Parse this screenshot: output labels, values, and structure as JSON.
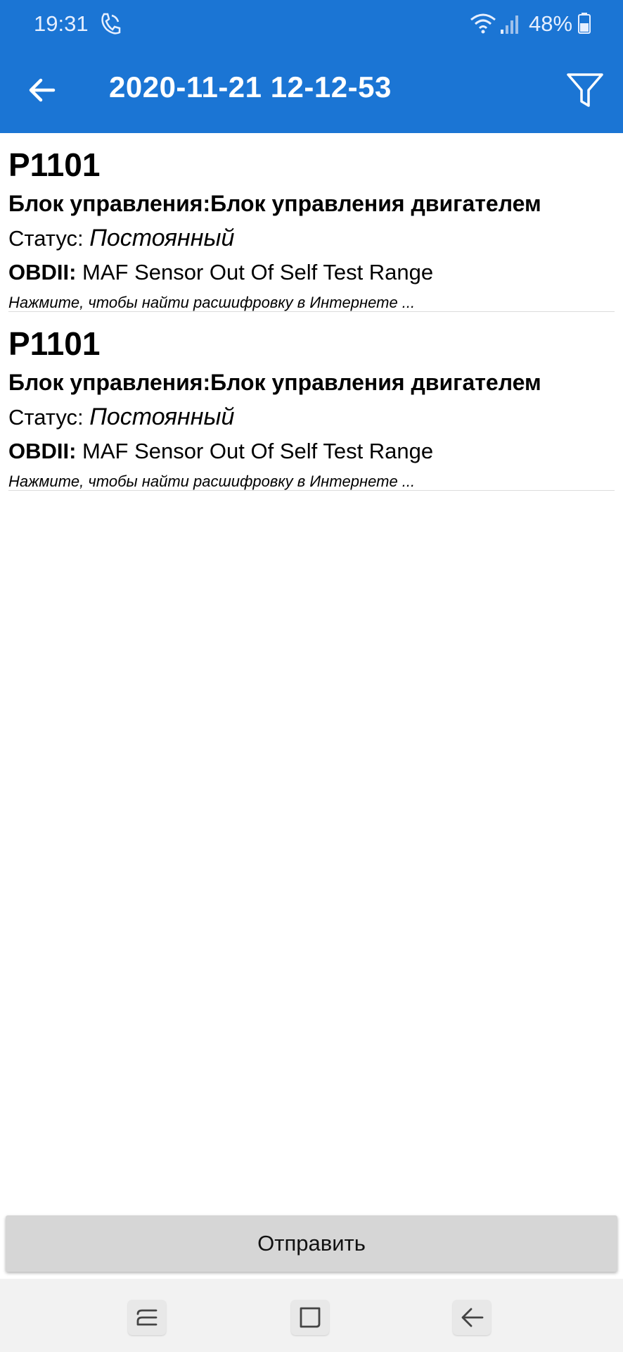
{
  "status_bar": {
    "time": "19:31",
    "battery_percent": "48%",
    "icons": [
      "phone-call-icon",
      "wifi-icon",
      "signal-icon",
      "battery-icon"
    ]
  },
  "toolbar": {
    "title": "2020-11-21 12-12-53",
    "back_icon": "arrow-left-icon",
    "filter_icon": "filter-icon",
    "background_color": "#1b75d4"
  },
  "items": [
    {
      "code": "P1101",
      "module": "Блок управления:Блок управления двигателем",
      "status_label": "Статус: ",
      "status_value": "Постоянный",
      "obd_label": "OBDII:",
      "obd_desc": " MAF Sensor Out Of Self Test Range",
      "hint": "Нажмите, чтобы найти расшифровку в Интернете ..."
    },
    {
      "code": "P1101",
      "module": "Блок управления:Блок управления двигателем",
      "status_label": "Статус: ",
      "status_value": "Постоянный",
      "obd_label": "OBDII:",
      "obd_desc": " MAF Sensor Out Of Self Test Range",
      "hint": "Нажмите, чтобы найти расшифровку в Интернете ..."
    }
  ],
  "send_button_label": "Отправить",
  "nav_bar": {
    "icons": [
      "recents-icon",
      "home-icon",
      "back-icon"
    ]
  }
}
